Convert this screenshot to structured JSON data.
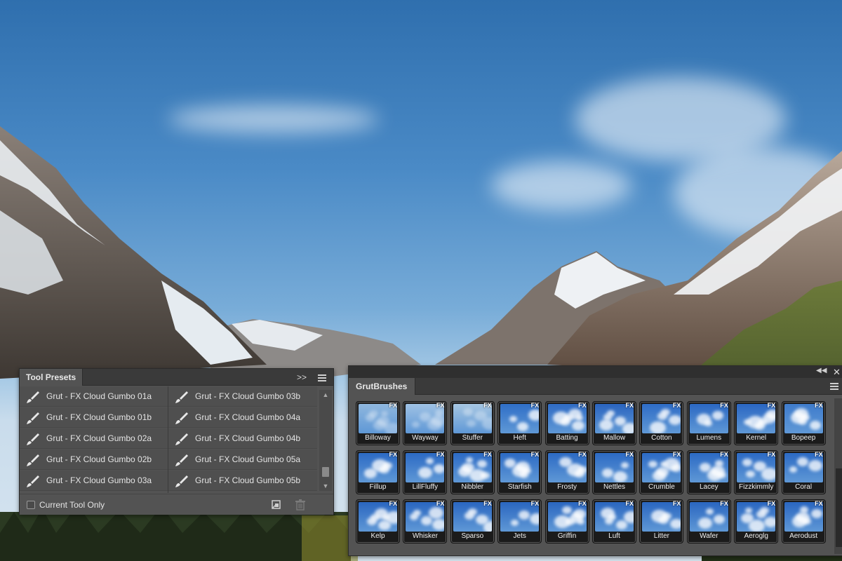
{
  "tool_presets": {
    "tab_label": "Tool Presets",
    "collapse_label": ">>",
    "items": [
      "Grut - FX Cloud Gumbo 01a",
      "Grut - FX Cloud Gumbo 03b",
      "Grut - FX Cloud Gumbo 01b",
      "Grut - FX Cloud Gumbo 04a",
      "Grut - FX Cloud Gumbo 02a",
      "Grut - FX Cloud Gumbo 04b",
      "Grut - FX Cloud Gumbo 02b",
      "Grut - FX Cloud Gumbo 05a",
      "Grut - FX Cloud Gumbo 03a",
      "Grut - FX Cloud Gumbo 05b"
    ],
    "current_tool_only_label": "Current Tool Only"
  },
  "grut_brushes": {
    "tab_label": "GrutBrushes",
    "badge": "FX",
    "tiles": [
      "Billoway",
      "Wayway",
      "Stuffer",
      "Heft",
      "Batting",
      "Mallow",
      "Cotton",
      "Lumens",
      "Kernel",
      "Bopeep",
      "Fillup",
      "LillFluffy",
      "Nibbler",
      "Starfish",
      "Frosty",
      "Nettles",
      "Crumble",
      "Lacey",
      "Fizzkimmly",
      "Coral",
      "Kelp",
      "Whisker",
      "Sparso",
      "Jets",
      "Griffin",
      "Luft",
      "Litter",
      "Wafer",
      "Aeroglg",
      "Aerodust"
    ]
  },
  "colors": {
    "panel_bg": "#535353",
    "header_bg": "#3a3a3a",
    "text": "#e4e4e4",
    "tile_sky": "#2a69c4"
  }
}
